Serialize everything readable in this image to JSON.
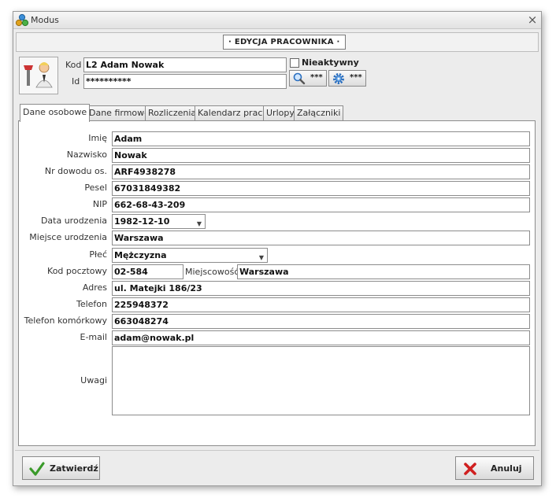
{
  "window": {
    "title": "Modus",
    "close": "×"
  },
  "header": {
    "title": "· EDYCJA PRACOWNIKA ·"
  },
  "top": {
    "kod_label": "Kod",
    "kod_value": "L2 Adam Nowak",
    "id_label": "Id",
    "id_value": "**********",
    "inactive_label": "Nieaktywny",
    "search_dots": "***",
    "settings_dots": "***"
  },
  "tabs": [
    {
      "label": "Dane osobowe",
      "active": true
    },
    {
      "label": "Dane firmowe"
    },
    {
      "label": "Rozliczenia"
    },
    {
      "label": "Kalendarz pracy"
    },
    {
      "label": "Urlopy"
    },
    {
      "label": "Załączniki"
    }
  ],
  "form": {
    "imie": {
      "label": "Imię",
      "value": "Adam"
    },
    "nazwisko": {
      "label": "Nazwisko",
      "value": "Nowak"
    },
    "dowod": {
      "label": "Nr dowodu os.",
      "value": "ARF4938278"
    },
    "pesel": {
      "label": "Pesel",
      "value": "67031849382"
    },
    "nip": {
      "label": "NIP",
      "value": "662-68-43-209"
    },
    "data_ur": {
      "label": "Data urodzenia",
      "value": "1982-12-10"
    },
    "miejsce_ur": {
      "label": "Miejsce urodzenia",
      "value": "Warszawa"
    },
    "plec": {
      "label": "Płeć",
      "value": "Mężczyzna"
    },
    "kod_pocztowy": {
      "label": "Kod pocztowy",
      "value": "02-584"
    },
    "miejscowosc": {
      "label": "Miejscowość",
      "value": "Warszawa"
    },
    "adres": {
      "label": "Adres",
      "value": "ul. Matejki 186/23"
    },
    "telefon": {
      "label": "Telefon",
      "value": "225948372"
    },
    "tel_kom": {
      "label": "Telefon komórkowy",
      "value": "663048274"
    },
    "email": {
      "label": "E-mail",
      "value": "adam@nowak.pl"
    },
    "uwagi": {
      "label": "Uwagi",
      "value": ""
    }
  },
  "buttons": {
    "confirm": "Zatwierdź",
    "cancel": "Anuluj"
  },
  "colors": {
    "confirm_icon": "#3a9a2a",
    "cancel_icon": "#d02020",
    "accent_icon": "#2a6fc0"
  }
}
